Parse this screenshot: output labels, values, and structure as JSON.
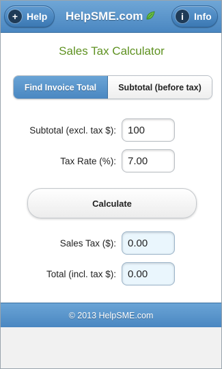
{
  "header": {
    "help_label": "Help",
    "info_label": "Info",
    "title": "HelpSME.com",
    "help_icon": "plus-icon",
    "info_icon": "info-icon",
    "leaf_icon": "leaf-icon"
  },
  "app_title": "Sales Tax Calculator",
  "mode_tabs": {
    "active": "Find Invoice Total",
    "inactive": "Subtotal (before tax)"
  },
  "inputs": {
    "subtotal_label": "Subtotal (excl. tax $):",
    "subtotal_value": "100",
    "tax_rate_label": "Tax Rate (%):",
    "tax_rate_value": "7.00"
  },
  "calculate_label": "Calculate",
  "outputs": {
    "sales_tax_label": "Sales Tax ($):",
    "sales_tax_value": "0.00",
    "total_label": "Total (incl. tax $):",
    "total_value": "0.00"
  },
  "footer": "© 2013 HelpSME.com",
  "colors": {
    "header_blue": "#4a87c1",
    "title_green": "#5e9120",
    "output_bg": "#eaf6fd"
  }
}
